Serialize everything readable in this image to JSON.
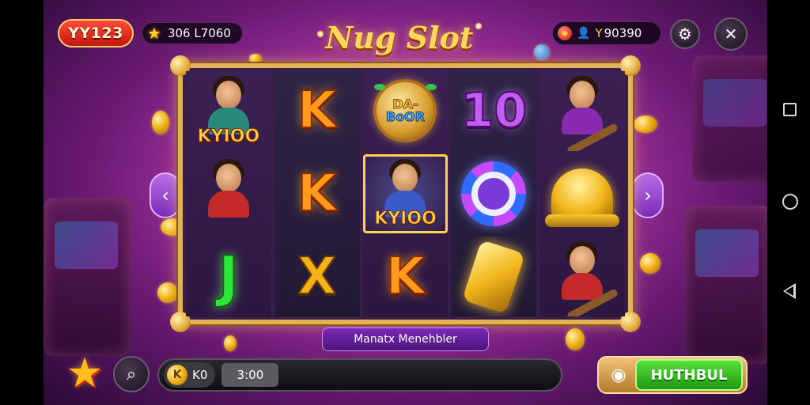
{
  "header": {
    "badge_label": "YY123",
    "coins": "306 L7060",
    "logo_text": "Nug Slot",
    "wallet_prefix": "Y",
    "wallet_amount": "90390"
  },
  "reels": [
    [
      {
        "type": "portrait",
        "label": "KYIOO",
        "icon": "woman-holding-staff-icon"
      },
      {
        "type": "portrait",
        "label": "",
        "icon": "woman-portrait-icon"
      },
      {
        "type": "letter",
        "symbol": "J",
        "icon": "green-j-symbol"
      }
    ],
    [
      {
        "type": "letter",
        "symbol": "K",
        "icon": "orange-k-symbol"
      },
      {
        "type": "letter",
        "symbol": "K",
        "icon": "orange-k-symbol"
      },
      {
        "type": "letter",
        "symbol": "X",
        "icon": "gold-x-symbol"
      }
    ],
    [
      {
        "type": "badge",
        "line1": "DA-",
        "line2": "BoOR",
        "icon": "da-boor-wild-badge"
      },
      {
        "type": "portrait",
        "label": "KYIOO",
        "icon": "king-raising-arms-icon",
        "win": true
      },
      {
        "type": "letter",
        "symbol": "K",
        "icon": "orange-k-symbol"
      }
    ],
    [
      {
        "type": "letter",
        "symbol": "10",
        "icon": "purple-10-symbol"
      },
      {
        "type": "chip",
        "icon": "purple-chip-icon"
      },
      {
        "type": "goldbar",
        "icon": "gold-bar-icon"
      }
    ],
    [
      {
        "type": "portrait",
        "label": "",
        "icon": "musician-woman-icon"
      },
      {
        "type": "bell",
        "icon": "golden-bell-icon"
      },
      {
        "type": "portrait",
        "label": "",
        "icon": "warrior-man-icon"
      }
    ]
  ],
  "banner": {
    "text": "Manatx Menehbler"
  },
  "bottom": {
    "bet_coin_value": "K0",
    "bet_coin_glyph": "K",
    "bet_amount": "3:00",
    "spin_label": "HUTHBUL"
  },
  "colors": {
    "accent_gold": "#e2b356",
    "spin_green": "#2fc21f",
    "badge_red": "#e0261a"
  }
}
